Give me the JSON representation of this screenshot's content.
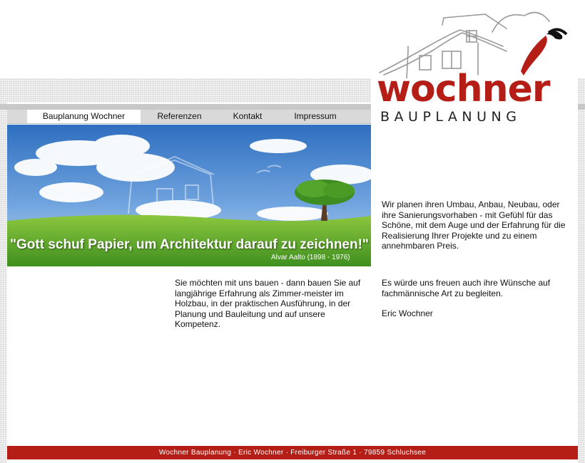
{
  "brand": {
    "name": "wochner",
    "subtitle": "BAUPLANUNG",
    "colors": {
      "accent": "#b41e17",
      "dark": "#222222"
    }
  },
  "nav": {
    "items": [
      {
        "label": "Bauplanung Wochner",
        "active": true
      },
      {
        "label": "Referenzen",
        "active": false
      },
      {
        "label": "Kontakt",
        "active": false
      },
      {
        "label": "Impressum",
        "active": false
      }
    ]
  },
  "banner": {
    "quote": "\"Gott schuf Papier, um Architektur darauf zu zeichnen!\"",
    "author": "Alvar Aalto (1898 - 1976)"
  },
  "intro": {
    "text": "Wir planen ihren Umbau, Anbau, Neubau, oder ihre Sanierungsvorhaben - mit Gefühl für das Schöne, mit dem Auge und der Erfahrung für die Realisierung Ihrer Projekte und zu einem annehmbaren Preis."
  },
  "left_text": {
    "text": "Sie möchten mit uns bauen - dann bauen Sie auf langjährige Erfahrung als Zimmer-meister im Holzbau, in der praktischen Ausführung, in der Planung und Bauleitung und auf unsere Kompetenz."
  },
  "right_text": {
    "text": "Es würde uns freuen auch ihre Wünsche auf fachmännische Art zu begleiten.",
    "signature": "Eric Wochner"
  },
  "footer": {
    "text": "Wochner Bauplanung · Eric Wochner · Freiburger Straße 1 · 79859 Schluchsee"
  }
}
